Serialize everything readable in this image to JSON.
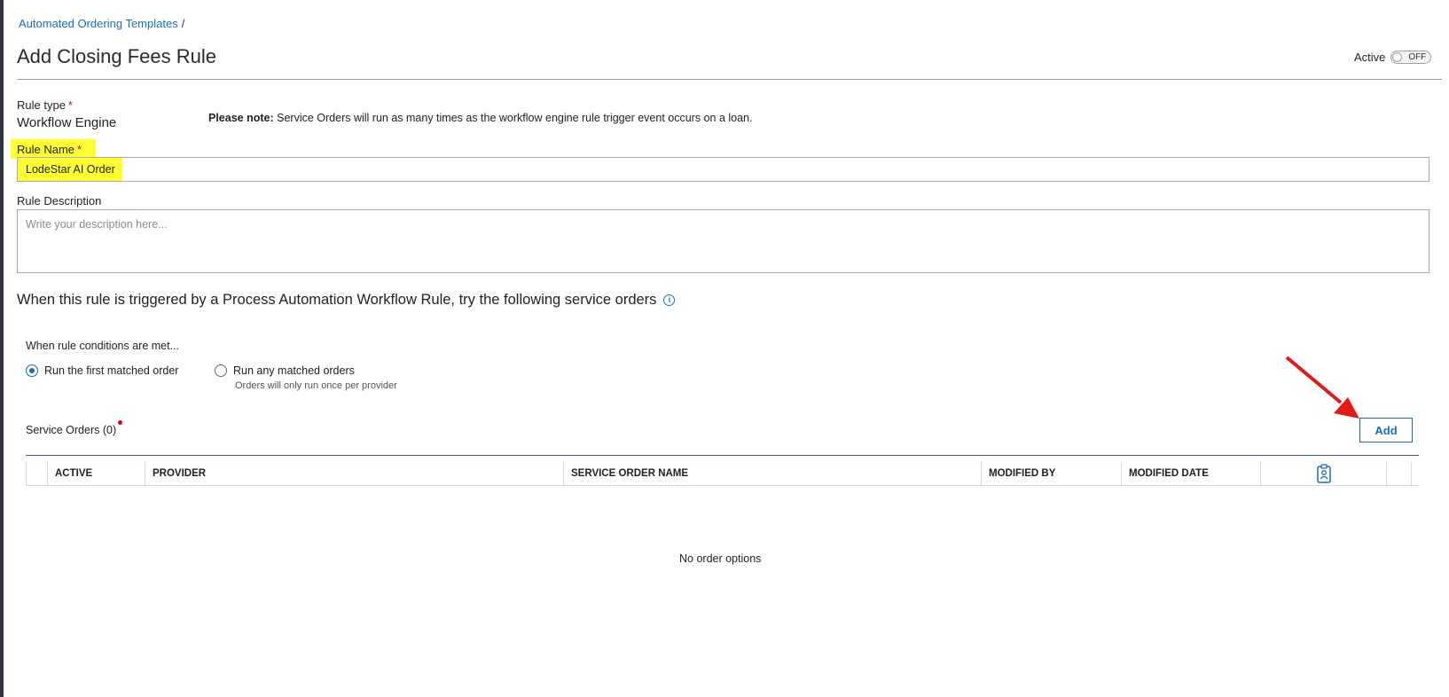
{
  "breadcrumb": {
    "link": "Automated Ordering Templates",
    "separator": "/"
  },
  "page_title": "Add Closing Fees Rule",
  "active_toggle": {
    "label": "Active",
    "state": "OFF"
  },
  "rule_type": {
    "label": "Rule type",
    "required_mark": "*",
    "value": "Workflow Engine"
  },
  "note": {
    "bold": "Please note:",
    "text": "Service Orders will run as many times as the workflow engine rule trigger event occurs on a loan."
  },
  "rule_name": {
    "label": "Rule Name",
    "required_mark": "*",
    "value": "LodeStar AI Order"
  },
  "rule_description": {
    "label": "Rule Description",
    "placeholder": "Write your description here..."
  },
  "section_heading": "When this rule is triggered by a Process Automation Workflow Rule, try the following service orders",
  "conditions": {
    "label": "When rule conditions are met...",
    "options": [
      {
        "label": "Run the first matched order",
        "selected": true
      },
      {
        "label": "Run any matched orders",
        "selected": false,
        "sublabel": "Orders will only run once per provider"
      }
    ]
  },
  "service_orders": {
    "label": "Service Orders (0)",
    "add_label": "Add",
    "columns": [
      "ACTIVE",
      "PROVIDER",
      "SERVICE ORDER NAME",
      "MODIFIED BY",
      "MODIFIED DATE"
    ],
    "empty_message": "No order options"
  },
  "colors": {
    "link": "#1a6fb5",
    "highlight": "#ffff33",
    "required": "#d0021b",
    "arrow": "#e01b1b"
  }
}
